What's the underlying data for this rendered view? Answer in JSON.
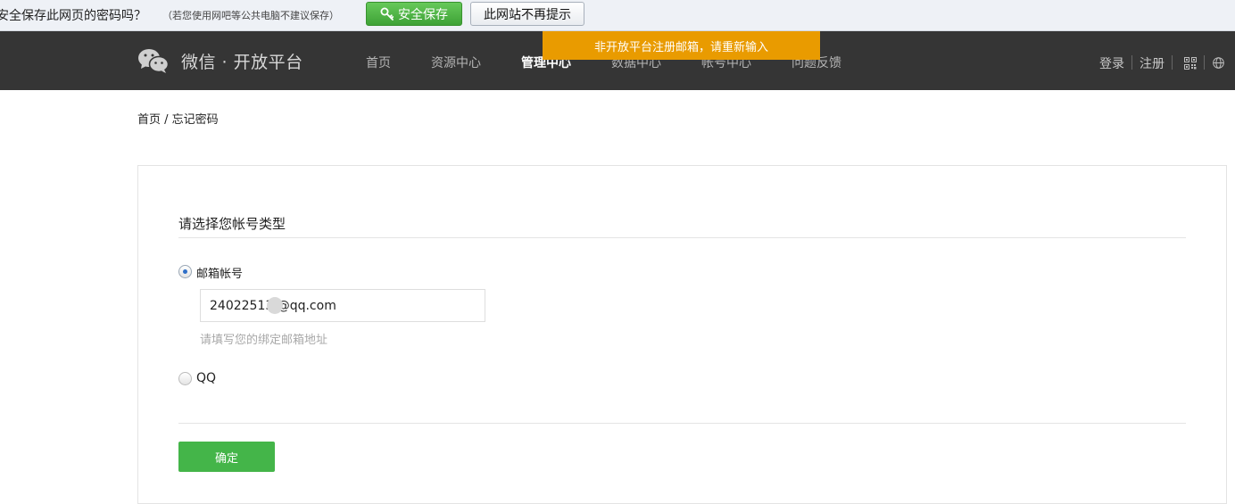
{
  "password_bar": {
    "question": "安全保存此网页的密码吗？",
    "note": "（若您使用网吧等公共电脑不建议保存）",
    "save_label": "安全保存",
    "never_label": "此网站不再提示",
    "icon": "key-icon"
  },
  "header": {
    "brand": "微信 · 开放平台",
    "logo_icon": "wechat-logo-icon",
    "nav": [
      {
        "label": "首页",
        "active": false
      },
      {
        "label": "资源中心",
        "active": false
      },
      {
        "label": "管理中心",
        "active": true
      },
      {
        "label": "数据中心",
        "active": false
      },
      {
        "label": "帐号中心",
        "active": false
      },
      {
        "label": "问题反馈",
        "active": false
      }
    ],
    "login": "登录",
    "register": "注册",
    "right_icons": [
      "qr-code-icon",
      "globe-icon"
    ]
  },
  "toast": {
    "message": "非开放平台注册邮箱，请重新输入"
  },
  "breadcrumb": {
    "home": "首页",
    "separator": " / ",
    "current": "忘记密码"
  },
  "form": {
    "section_title": "请选择您帐号类型",
    "options": [
      {
        "label": "邮箱帐号",
        "selected": true
      },
      {
        "label": "QQ",
        "selected": false
      }
    ],
    "email_value": "24022513 @qq.com",
    "email_hint": "请填写您的绑定邮箱地址",
    "submit_label": "确定"
  },
  "colors": {
    "nav_bg": "#353535",
    "toast_bg": "#e99b00",
    "primary_green": "#44b549",
    "save_button_green": "#4fb545"
  }
}
